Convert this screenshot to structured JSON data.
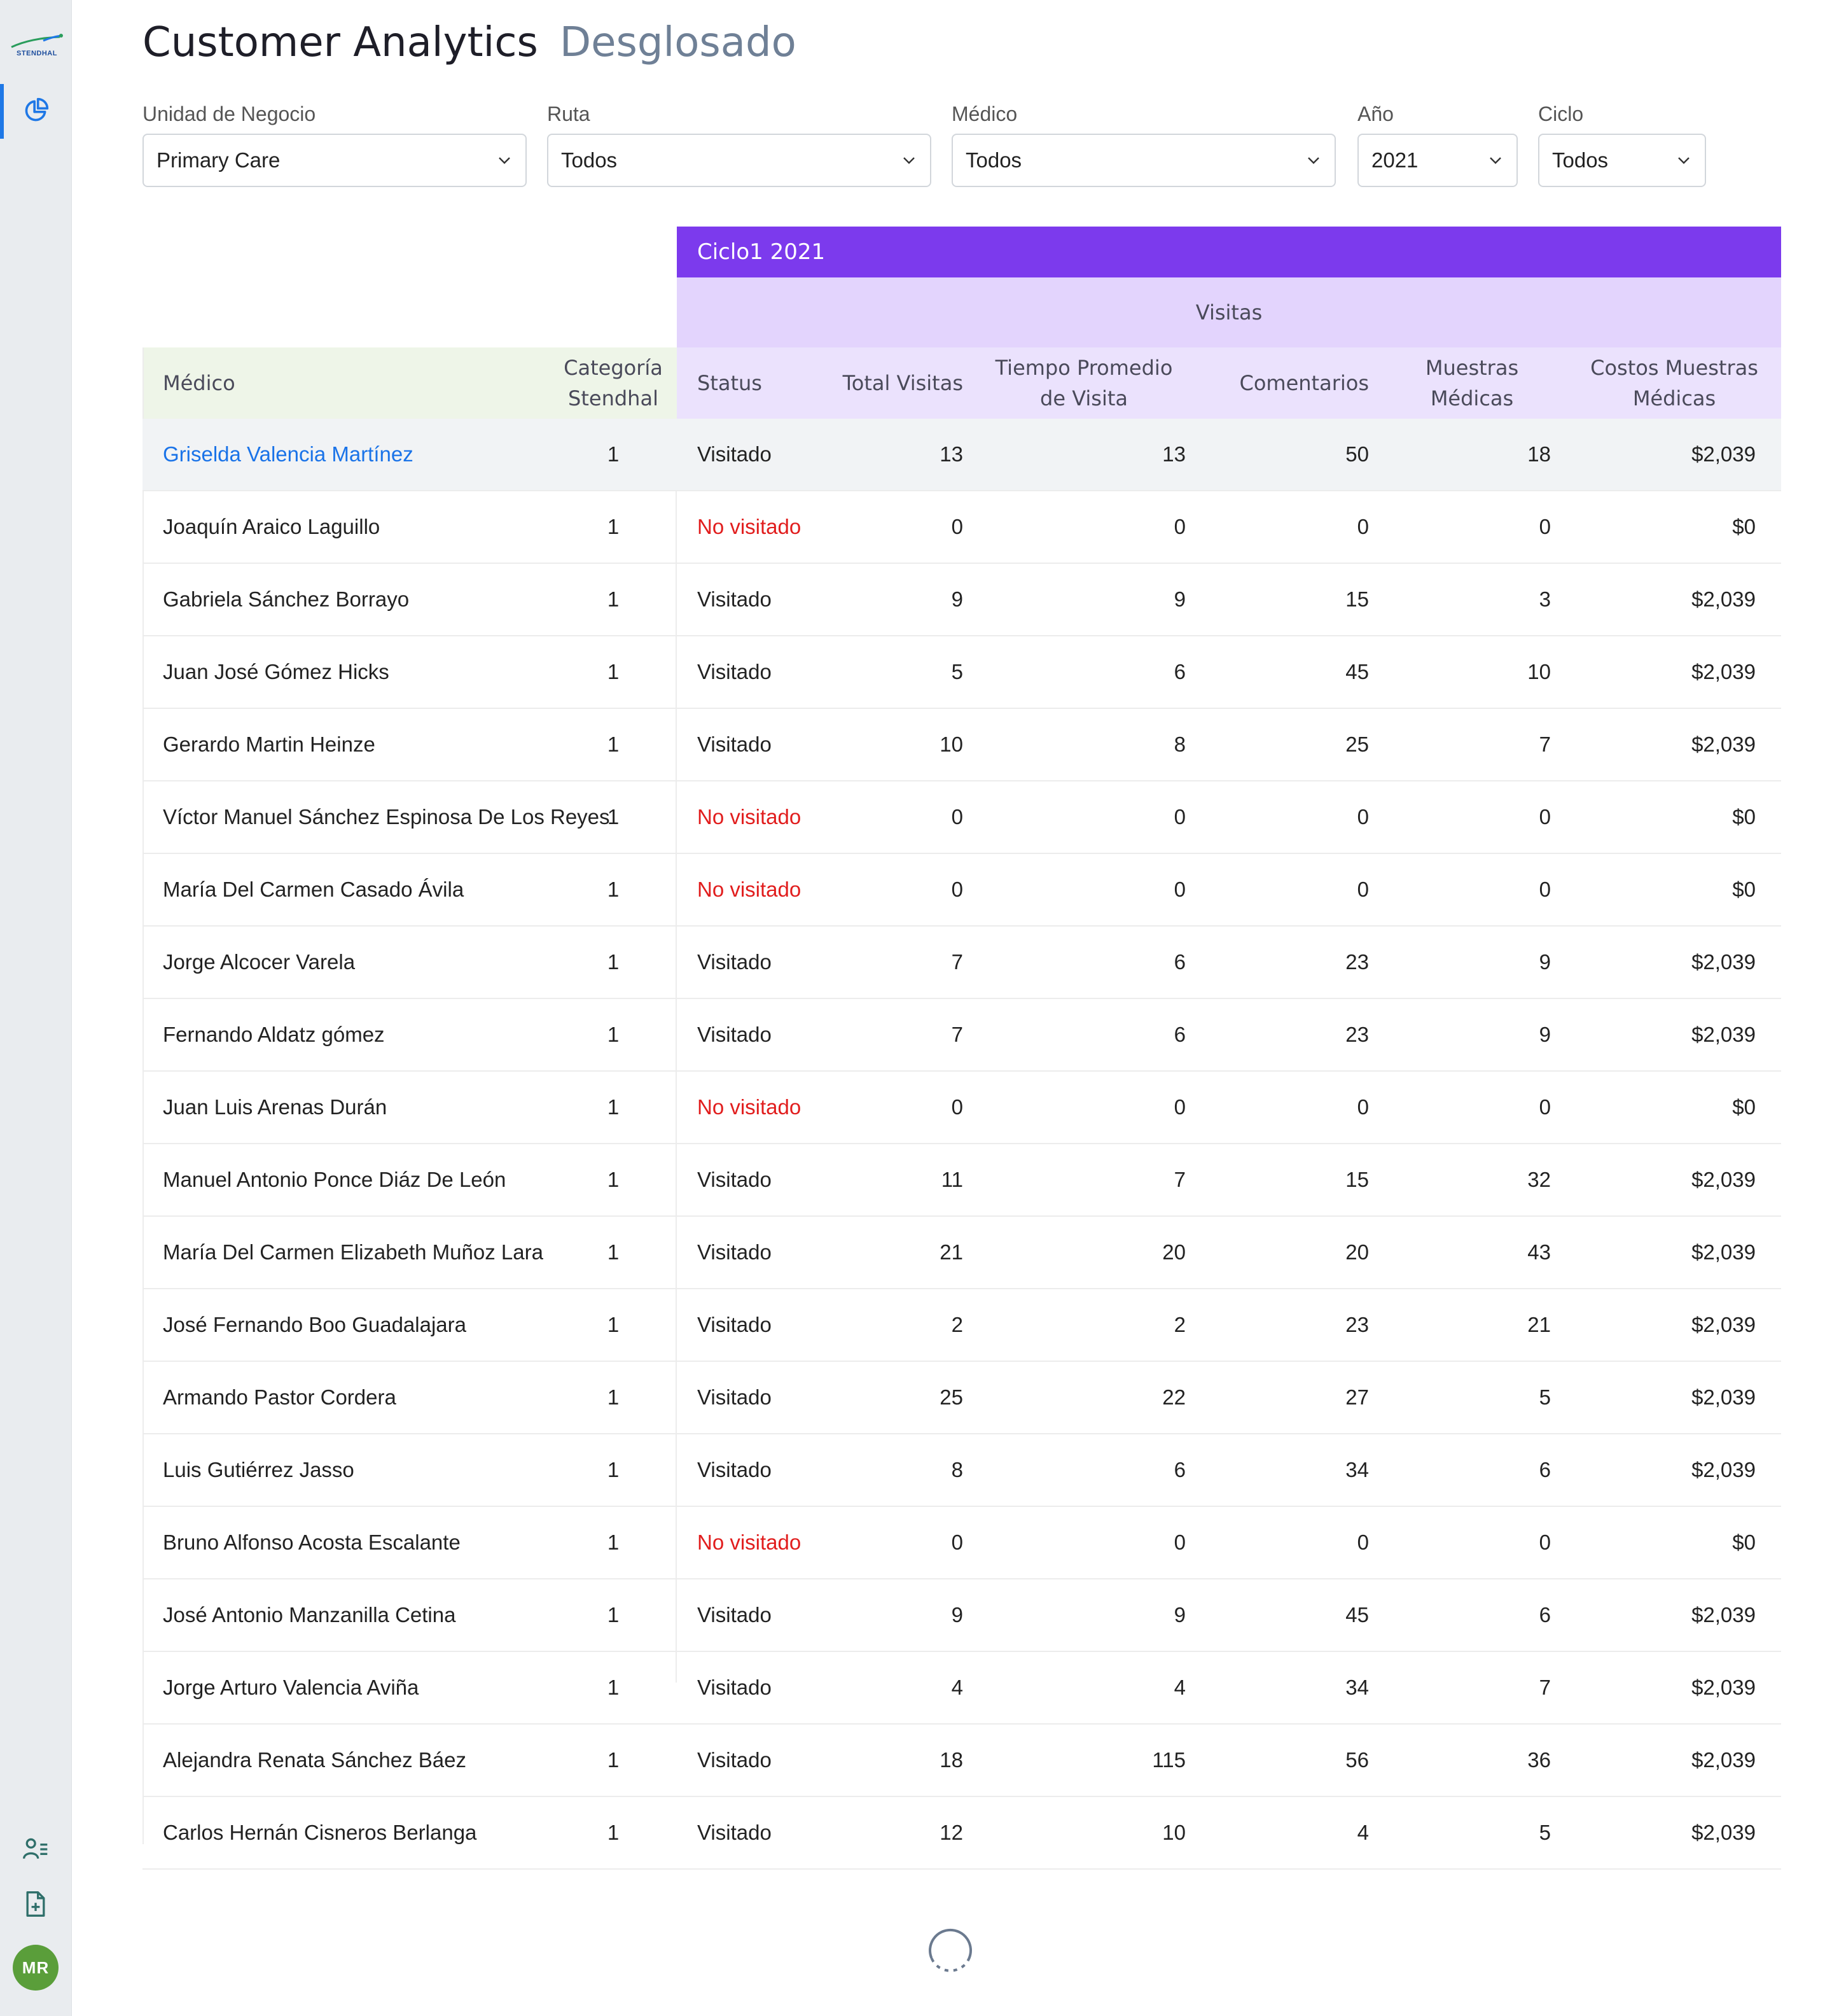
{
  "brand": {
    "logo_text": "STENDHAL"
  },
  "header": {
    "title": "Customer Analytics",
    "subtitle": "Desglosado"
  },
  "filters": [
    {
      "label": "Unidad de Negocio",
      "value": "Primary Care"
    },
    {
      "label": "Ruta",
      "value": "Todos"
    },
    {
      "label": "Médico",
      "value": "Todos"
    },
    {
      "label": "Año",
      "value": "2021"
    },
    {
      "label": "Ciclo",
      "value": "Todos"
    }
  ],
  "table": {
    "cycle_header": "Ciclo1 2021",
    "group_header": "Visitas",
    "columns": {
      "medico": "Médico",
      "categoria_1": "Categoría",
      "categoria_2": "Stendhal",
      "status": "Status",
      "total": "Total Visitas",
      "tiempo_1": "Tiempo Promedio",
      "tiempo_2": "de Visita",
      "comentarios": "Comentarios",
      "muestras_1": "Muestras",
      "muestras_2": "Médicas",
      "costos_1": "Costos Muestras",
      "costos_2": "Médicas"
    },
    "rows": [
      {
        "name": "Griselda Valencia Martínez",
        "cat": "1",
        "status": "Visitado",
        "total": "13",
        "tiempo": "13",
        "comentarios": "50",
        "muestras": "18",
        "costo": "$2,039"
      },
      {
        "name": "Joaquín Araico Laguillo",
        "cat": "1",
        "status": "No visitado",
        "total": "0",
        "tiempo": "0",
        "comentarios": "0",
        "muestras": "0",
        "costo": "$0"
      },
      {
        "name": "Gabriela Sánchez Borrayo",
        "cat": "1",
        "status": "Visitado",
        "total": "9",
        "tiempo": "9",
        "comentarios": "15",
        "muestras": "3",
        "costo": "$2,039"
      },
      {
        "name": "Juan José Gómez Hicks",
        "cat": "1",
        "status": "Visitado",
        "total": "5",
        "tiempo": "6",
        "comentarios": "45",
        "muestras": "10",
        "costo": "$2,039"
      },
      {
        "name": "Gerardo Martin Heinze",
        "cat": "1",
        "status": "Visitado",
        "total": "10",
        "tiempo": "8",
        "comentarios": "25",
        "muestras": "7",
        "costo": "$2,039"
      },
      {
        "name": "Víctor Manuel Sánchez Espinosa De Los Reyes",
        "cat": "1",
        "status": "No visitado",
        "total": "0",
        "tiempo": "0",
        "comentarios": "0",
        "muestras": "0",
        "costo": "$0"
      },
      {
        "name": "María Del Carmen Casado Ávila",
        "cat": "1",
        "status": "No visitado",
        "total": "0",
        "tiempo": "0",
        "comentarios": "0",
        "muestras": "0",
        "costo": "$0"
      },
      {
        "name": "Jorge Alcocer Varela",
        "cat": "1",
        "status": "Visitado",
        "total": "7",
        "tiempo": "6",
        "comentarios": "23",
        "muestras": "9",
        "costo": "$2,039"
      },
      {
        "name": "Fernando Aldatz gómez",
        "cat": "1",
        "status": "Visitado",
        "total": "7",
        "tiempo": "6",
        "comentarios": "23",
        "muestras": "9",
        "costo": "$2,039"
      },
      {
        "name": "Juan Luis Arenas Durán",
        "cat": "1",
        "status": "No visitado",
        "total": "0",
        "tiempo": "0",
        "comentarios": "0",
        "muestras": "0",
        "costo": "$0"
      },
      {
        "name": "Manuel Antonio Ponce Diáz De León",
        "cat": "1",
        "status": "Visitado",
        "total": "11",
        "tiempo": "7",
        "comentarios": "15",
        "muestras": "32",
        "costo": "$2,039"
      },
      {
        "name": "María Del Carmen Elizabeth Muñoz Lara",
        "cat": "1",
        "status": "Visitado",
        "total": "21",
        "tiempo": "20",
        "comentarios": "20",
        "muestras": "43",
        "costo": "$2,039"
      },
      {
        "name": "José Fernando Boo Guadalajara",
        "cat": "1",
        "status": "Visitado",
        "total": "2",
        "tiempo": "2",
        "comentarios": "23",
        "muestras": "21",
        "costo": "$2,039"
      },
      {
        "name": "Armando Pastor Cordera",
        "cat": "1",
        "status": "Visitado",
        "total": "25",
        "tiempo": "22",
        "comentarios": "27",
        "muestras": "5",
        "costo": "$2,039"
      },
      {
        "name": "Luis Gutiérrez Jasso",
        "cat": "1",
        "status": "Visitado",
        "total": "8",
        "tiempo": "6",
        "comentarios": "34",
        "muestras": "6",
        "costo": "$2,039"
      },
      {
        "name": "Bruno Alfonso Acosta Escalante",
        "cat": "1",
        "status": "No visitado",
        "total": "0",
        "tiempo": "0",
        "comentarios": "0",
        "muestras": "0",
        "costo": "$0"
      },
      {
        "name": "José Antonio Manzanilla Cetina",
        "cat": "1",
        "status": "Visitado",
        "total": "9",
        "tiempo": "9",
        "comentarios": "45",
        "muestras": "6",
        "costo": "$2,039"
      },
      {
        "name": "Jorge Arturo Valencia Aviña",
        "cat": "1",
        "status": "Visitado",
        "total": "4",
        "tiempo": "4",
        "comentarios": "34",
        "muestras": "7",
        "costo": "$2,039"
      },
      {
        "name": "Alejandra Renata Sánchez Báez",
        "cat": "1",
        "status": "Visitado",
        "total": "18",
        "tiempo": "115",
        "comentarios": "56",
        "muestras": "36",
        "costo": "$2,039"
      },
      {
        "name": "Carlos Hernán Cisneros Berlanga",
        "cat": "1",
        "status": "Visitado",
        "total": "12",
        "tiempo": "10",
        "comentarios": "4",
        "muestras": "5",
        "costo": "$2,039"
      }
    ]
  },
  "user": {
    "initials": "MR"
  },
  "icons": [
    "logo-icon",
    "analytics-icon",
    "user-list-icon",
    "add-document-icon",
    "chevron-down-icon",
    "spinner-icon"
  ],
  "colors": {
    "accent": "#7c3aed",
    "link": "#1a73e8",
    "not_visited": "#e11d1d",
    "avatar": "#5a9e3a"
  }
}
